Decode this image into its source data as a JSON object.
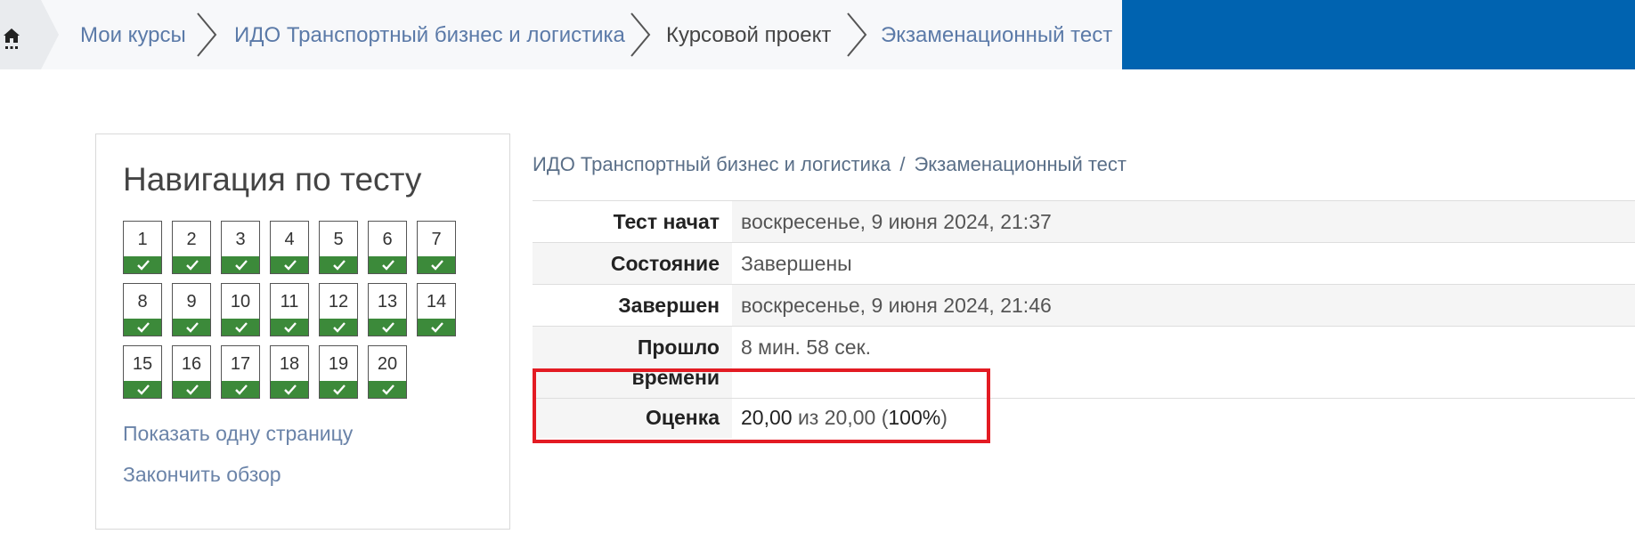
{
  "breadcrumb": {
    "home_icon": "home-icon",
    "items": [
      {
        "label": "Мои курсы"
      },
      {
        "label": "ИДО Транспортный бизнес и логистика"
      },
      {
        "label": "Курсовой проект"
      },
      {
        "label": "Экзаменационный тест"
      }
    ]
  },
  "navigation": {
    "title": "Навигация по тесту",
    "questions": [
      "1",
      "2",
      "3",
      "4",
      "5",
      "6",
      "7",
      "8",
      "9",
      "10",
      "11",
      "12",
      "13",
      "14",
      "15",
      "16",
      "17",
      "18",
      "19",
      "20"
    ],
    "state_icon": "check-icon",
    "state_color": "#3c8a3a",
    "links": {
      "show_one_page": "Показать одну страницу",
      "finish_review": "Закончить обзор"
    }
  },
  "page_breadcrumb": {
    "course": "ИДО Транспортный бизнес и логистика",
    "separator": "/",
    "quiz": "Экзаменационный тест"
  },
  "summary": {
    "started_label": "Тест начат",
    "started_value": "воскресенье, 9 июня 2024, 21:37",
    "state_label": "Состояние",
    "state_value": "Завершены",
    "completed_label": "Завершен",
    "completed_value": "воскресенье, 9 июня 2024, 21:46",
    "time_label_1": "Прошло",
    "time_label_2": "времени",
    "time_value": "8 мин. 58 сек.",
    "grade_label": "Оценка",
    "grade_score": "20,00",
    "grade_of": "из 20,00",
    "grade_open": "(",
    "grade_percent": "100%",
    "grade_close": ")"
  },
  "colors": {
    "accent_blue": "#0063b0",
    "highlight_red": "#e31b23",
    "answered_green": "#3c8a3a"
  }
}
